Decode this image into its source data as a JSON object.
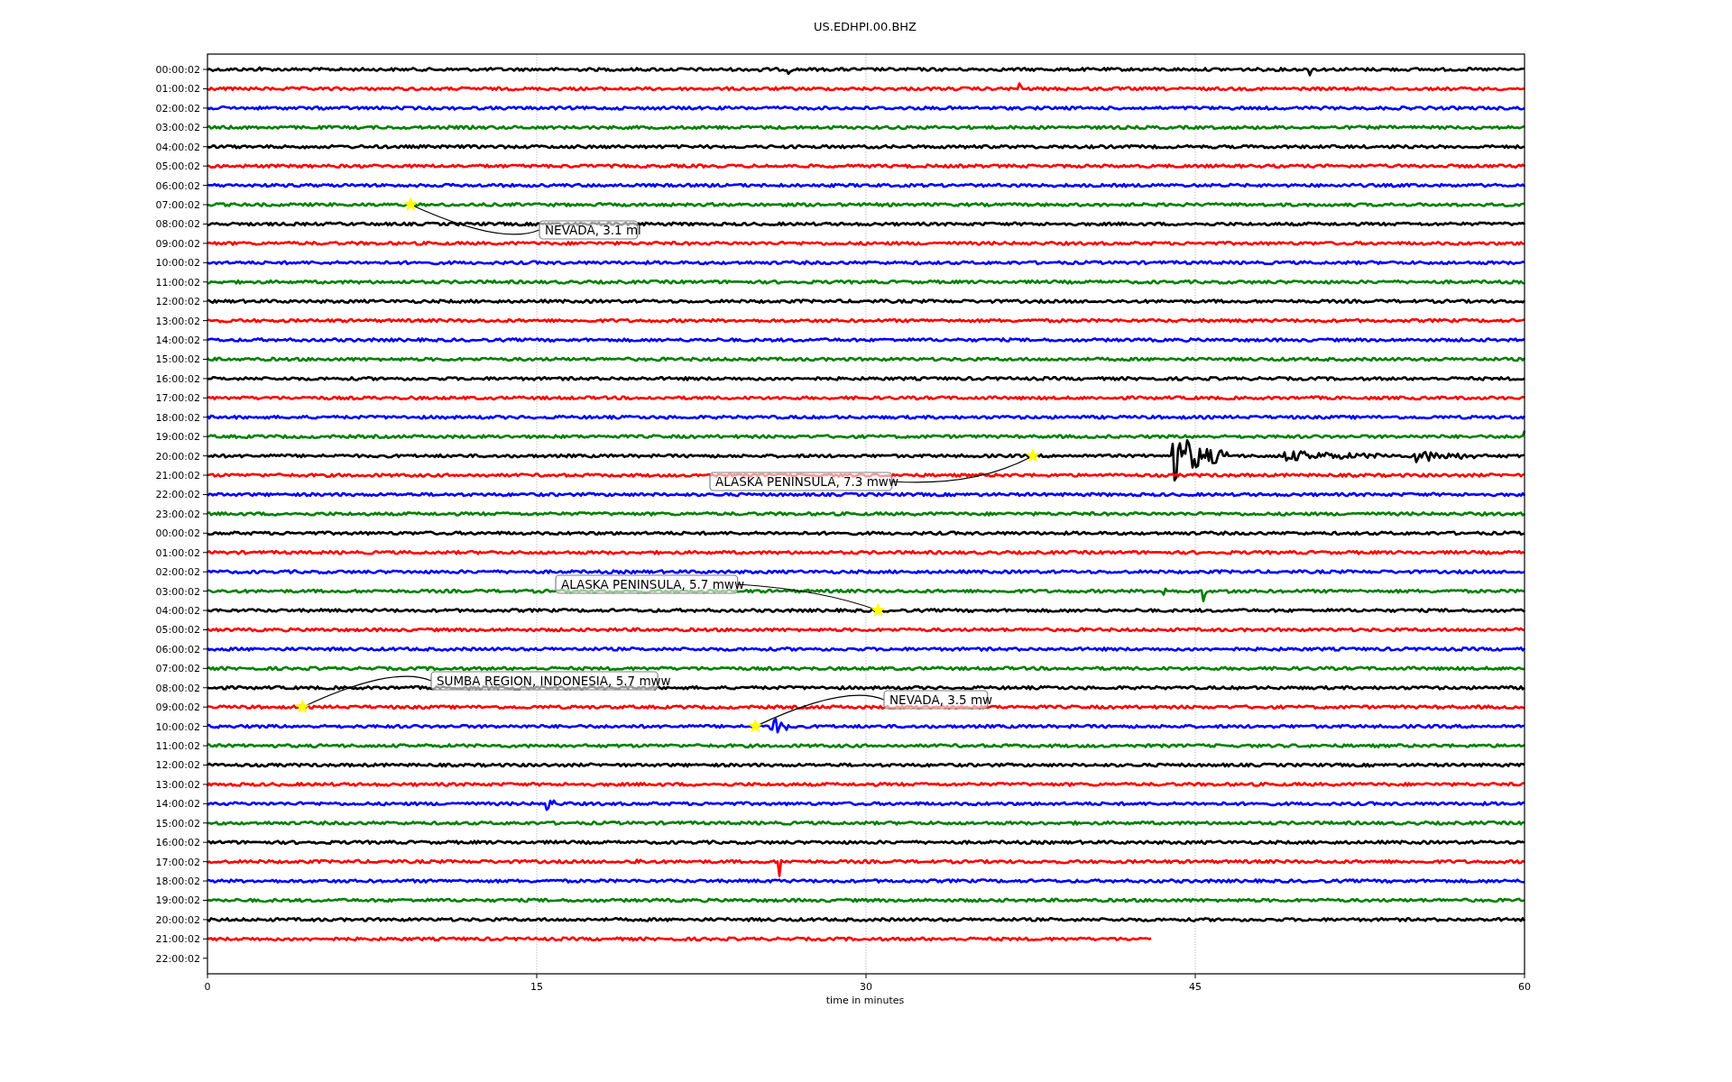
{
  "title": "US.EDHPI.00.BHZ",
  "xlabel": "time in minutes",
  "xticks": [
    "0",
    "15",
    "30",
    "45",
    "60"
  ],
  "rows": [
    {
      "label": "00:00:02",
      "color": "#000000"
    },
    {
      "label": "01:00:02",
      "color": "#ff0000"
    },
    {
      "label": "02:00:02",
      "color": "#0000ff"
    },
    {
      "label": "03:00:02",
      "color": "#008000"
    },
    {
      "label": "04:00:02",
      "color": "#000000"
    },
    {
      "label": "05:00:02",
      "color": "#ff0000"
    },
    {
      "label": "06:00:02",
      "color": "#0000ff"
    },
    {
      "label": "07:00:02",
      "color": "#008000"
    },
    {
      "label": "08:00:02",
      "color": "#000000"
    },
    {
      "label": "09:00:02",
      "color": "#ff0000"
    },
    {
      "label": "10:00:02",
      "color": "#0000ff"
    },
    {
      "label": "11:00:02",
      "color": "#008000"
    },
    {
      "label": "12:00:02",
      "color": "#000000"
    },
    {
      "label": "13:00:02",
      "color": "#ff0000"
    },
    {
      "label": "14:00:02",
      "color": "#0000ff"
    },
    {
      "label": "15:00:02",
      "color": "#008000"
    },
    {
      "label": "16:00:02",
      "color": "#000000"
    },
    {
      "label": "17:00:02",
      "color": "#ff0000"
    },
    {
      "label": "18:00:02",
      "color": "#0000ff"
    },
    {
      "label": "19:00:02",
      "color": "#008000"
    },
    {
      "label": "20:00:02",
      "color": "#000000"
    },
    {
      "label": "21:00:02",
      "color": "#ff0000"
    },
    {
      "label": "22:00:02",
      "color": "#0000ff"
    },
    {
      "label": "23:00:02",
      "color": "#008000"
    },
    {
      "label": "00:00:02",
      "color": "#000000"
    },
    {
      "label": "01:00:02",
      "color": "#ff0000"
    },
    {
      "label": "02:00:02",
      "color": "#0000ff"
    },
    {
      "label": "03:00:02",
      "color": "#008000"
    },
    {
      "label": "04:00:02",
      "color": "#000000"
    },
    {
      "label": "05:00:02",
      "color": "#ff0000"
    },
    {
      "label": "06:00:02",
      "color": "#0000ff"
    },
    {
      "label": "07:00:02",
      "color": "#008000"
    },
    {
      "label": "08:00:02",
      "color": "#000000"
    },
    {
      "label": "09:00:02",
      "color": "#ff0000"
    },
    {
      "label": "10:00:02",
      "color": "#0000ff"
    },
    {
      "label": "11:00:02",
      "color": "#008000"
    },
    {
      "label": "12:00:02",
      "color": "#000000"
    },
    {
      "label": "13:00:02",
      "color": "#ff0000"
    },
    {
      "label": "14:00:02",
      "color": "#0000ff"
    },
    {
      "label": "15:00:02",
      "color": "#008000"
    },
    {
      "label": "16:00:02",
      "color": "#000000"
    },
    {
      "label": "17:00:02",
      "color": "#ff0000"
    },
    {
      "label": "18:00:02",
      "color": "#0000ff"
    },
    {
      "label": "19:00:02",
      "color": "#008000"
    },
    {
      "label": "20:00:02",
      "color": "#000000"
    },
    {
      "label": "21:00:02",
      "color": "#ff0000",
      "level": 0.717
    },
    {
      "label": "22:00:02"
    }
  ],
  "events": [
    {
      "label": "NEVADA, 3.1 ml"
    },
    {
      "label": "ALASKA PENINSULA, 7.3 mww"
    },
    {
      "label": "ALASKA PENINSULA, 5.7 mww"
    },
    {
      "label": "SUMBA REGION, INDONESIA, 5.7 mww"
    },
    {
      "label": "NEVADA, 3.5 mw"
    }
  ]
}
